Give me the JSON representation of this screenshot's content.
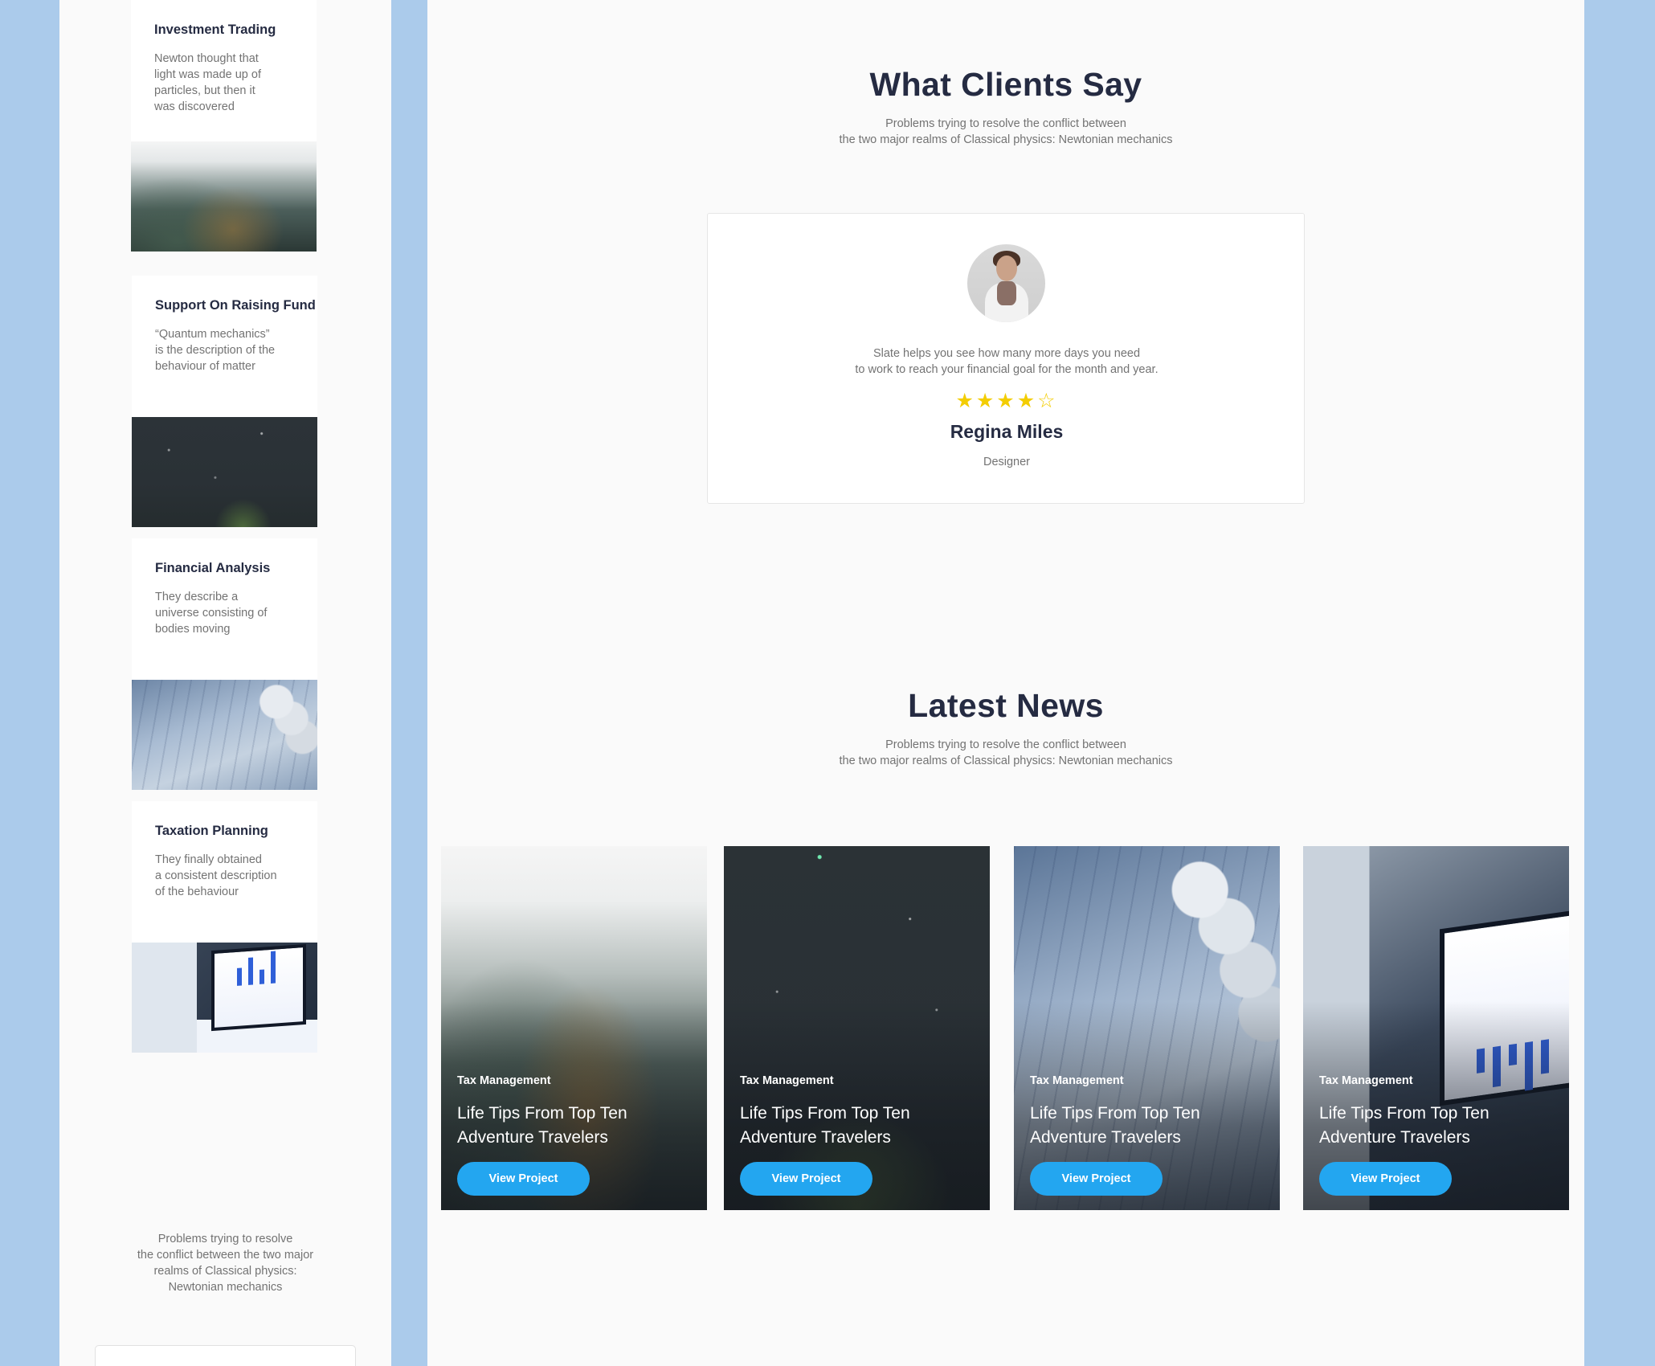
{
  "services": [
    {
      "title": "Investment Trading",
      "text": "Newton thought that\nlight was made up of\nparticles, but then it\nwas discovered",
      "image": "misty-forest-image"
    },
    {
      "title": "Support On Raising Fund",
      "text": "“Quantum mechanics”\nis the description of the\nbehaviour of matter",
      "image": "night-sky-image"
    },
    {
      "title": "Financial Analysis",
      "text": "They describe a\nuniverse consisting of\nbodies moving",
      "image": "coins-chart-image"
    },
    {
      "title": "Taxation Planning",
      "text": "They finally obtained\na consistent description\nof the behaviour",
      "image": "tablet-analytics-image"
    }
  ],
  "left_footer": {
    "text": "Problems trying to resolve\nthe conflict between the two major\nrealms of Classical physics:\nNewtonian mechanics"
  },
  "testimonials": {
    "heading": "What Clients Say",
    "subtitle": "Problems trying to resolve the conflict between\nthe two major realms of Classical physics: Newtonian mechanics",
    "quote": "Slate helps you see how many more days you need\nto work to reach your financial goal for the month and year.",
    "rating": 4,
    "rating_max": 5,
    "stars_text": "★★★★☆",
    "name": "Regina Miles",
    "role": "Designer",
    "star_color": "#f3cd03"
  },
  "news": {
    "heading": "Latest News",
    "subtitle": "Problems trying to resolve the conflict between\nthe two major realms of Classical physics: Newtonian mechanics",
    "cards": [
      {
        "category": "Tax Management",
        "title": "Life Tips From Top Ten Adventure Travelers",
        "button": "View Project",
        "image": "misty-forest-image"
      },
      {
        "category": "Tax Management",
        "title": "Life Tips From Top Ten Adventure Travelers",
        "button": "View Project",
        "image": "night-sky-image"
      },
      {
        "category": "Tax Management",
        "title": "Life Tips From Top Ten Adventure Travelers",
        "button": "View Project",
        "image": "coins-chart-image"
      },
      {
        "category": "Tax Management",
        "title": "Life Tips From Top Ten Adventure Travelers",
        "button": "View Project",
        "image": "tablet-analytics-image"
      }
    ]
  },
  "colors": {
    "page_background": "#abcbeb",
    "panel_background": "#fafafa",
    "heading": "#252b42",
    "muted_text": "#737373",
    "primary_button": "#23a6f0"
  }
}
